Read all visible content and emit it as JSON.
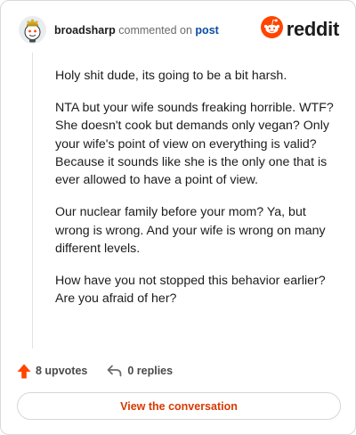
{
  "header": {
    "username": "broadsharp",
    "action": "commented on",
    "post_link": "post",
    "logo_text": "reddit"
  },
  "comment": {
    "paragraphs": [
      "Holy shit dude, its going to be a bit harsh.",
      "NTA but your wife sounds freaking horrible. WTF? She doesn't cook but demands only vegan? Only your wife's point of view on everything is valid? Because it sounds like she is the only one that is ever allowed to have a point of view.",
      "Our nuclear family before your mom? Ya, but wrong is wrong. And your wife is wrong on many different levels.",
      "How have you not stopped this behavior earlier? Are you afraid of her?"
    ]
  },
  "footer": {
    "upvotes": "8 upvotes",
    "replies": "0 replies",
    "view_button": "View the conversation"
  },
  "colors": {
    "brand": "#ff4500",
    "link": "#0a4fa3",
    "button_text": "#d93a00"
  },
  "icons": {
    "avatar": "snoo-avatar-icon",
    "logo": "reddit-snoo-icon",
    "upvote": "upvote-arrow-icon",
    "reply": "reply-arrow-icon"
  }
}
